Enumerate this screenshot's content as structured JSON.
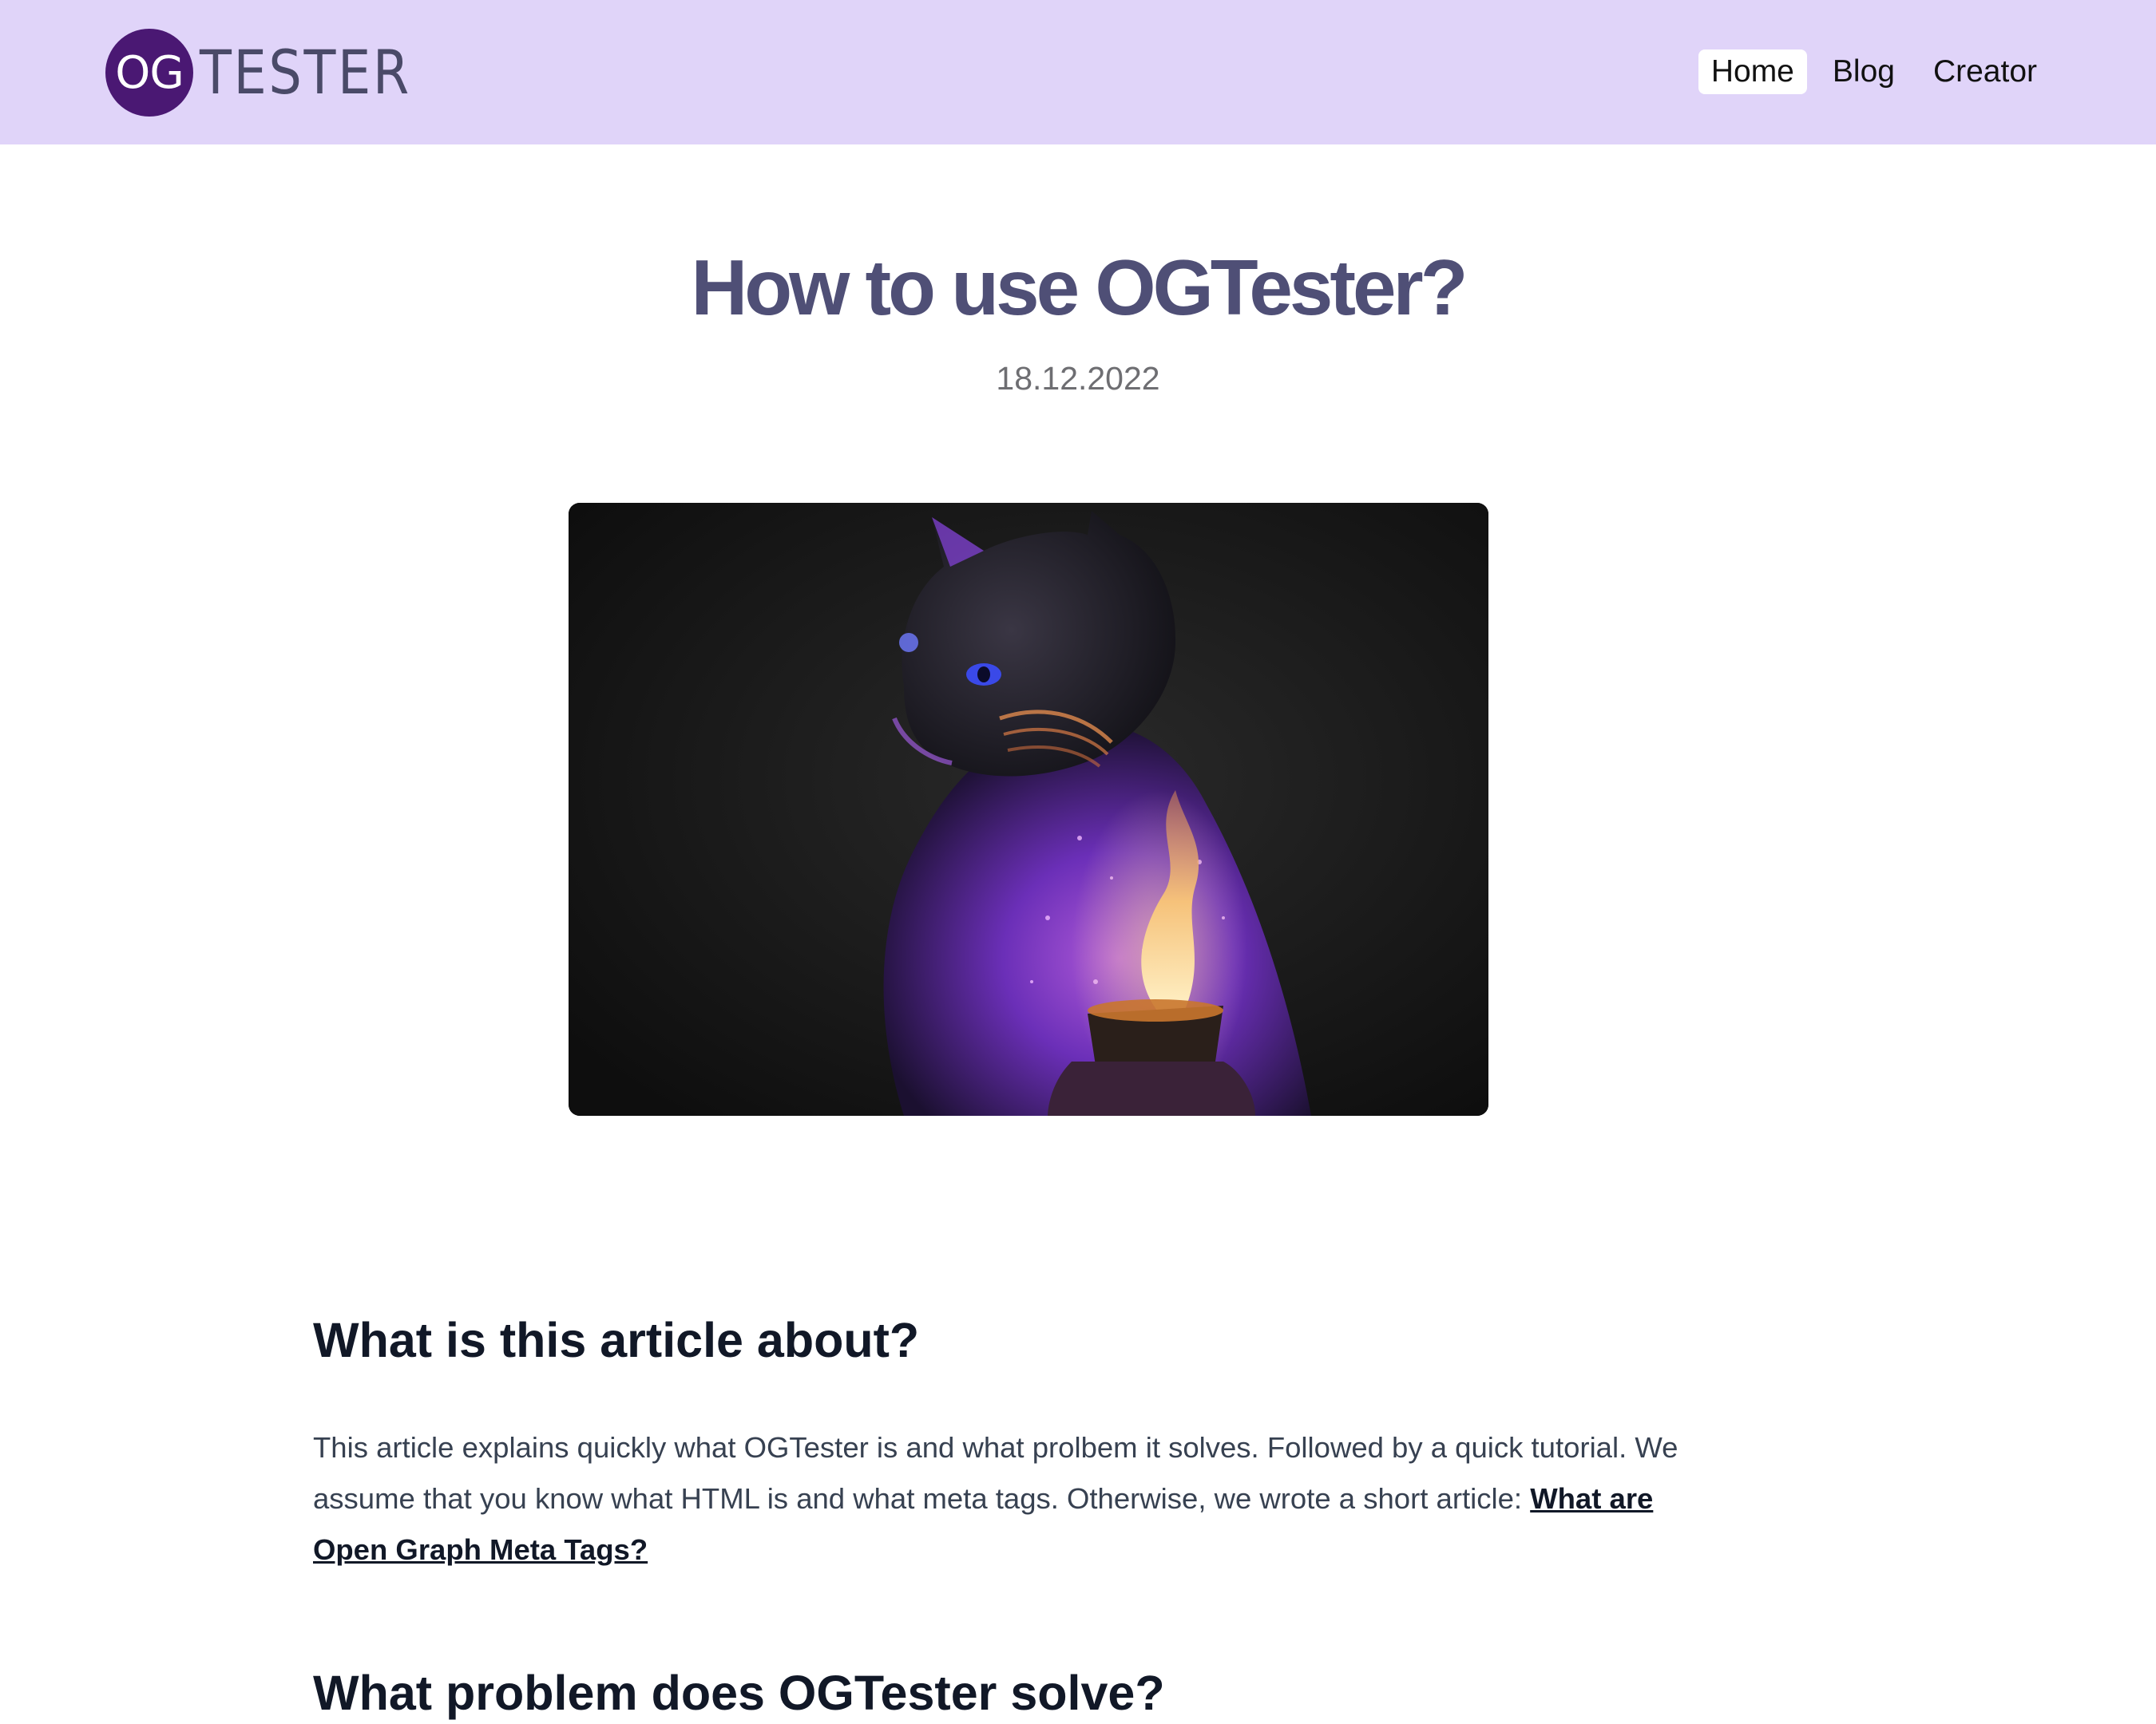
{
  "header": {
    "logo_mark": "OG",
    "logo_word": "TESTER",
    "nav": {
      "home": "Home",
      "blog": "Blog",
      "creator": "Creator"
    }
  },
  "article": {
    "title": "How to use OGTester?",
    "date": "18.12.2022",
    "hero_image": "cat-with-candle-image",
    "section1_heading": "What is this article about?",
    "section1_text": "This article explains quickly what OGTester is and what prolbem it solves. Followed by a quick tutorial. We assume that you know what HTML is and what meta tags. Otherwise, we wrote a short article: ",
    "section1_link": "What are Open Graph Meta Tags?",
    "section2_heading": "What problem does OGTester solve?"
  },
  "colors": {
    "header_bg": "#e0d4f9",
    "logo_circle": "#4a1873",
    "title": "#4f4f76"
  }
}
